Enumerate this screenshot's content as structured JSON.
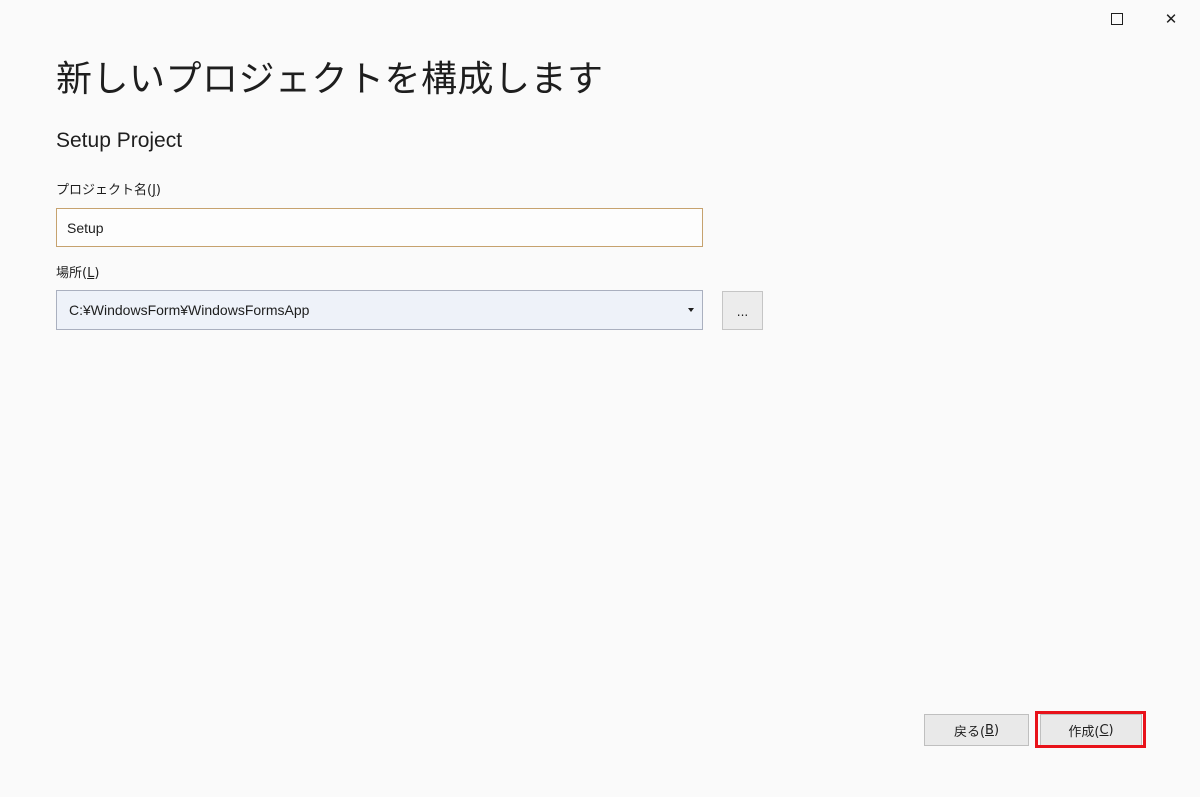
{
  "titlebar": {
    "maximize_icon": "maximize-icon",
    "close_icon": "close-icon",
    "close_glyph": "✕"
  },
  "page": {
    "title": "新しいプロジェクトを構成します",
    "subtitle": "Setup Project"
  },
  "project_name": {
    "label": "プロジェクト名(",
    "mnemonic": "J",
    "label_end": ")",
    "value": "Setup"
  },
  "location": {
    "label": "場所(",
    "mnemonic": "L",
    "label_end": ")",
    "value": "C:¥WindowsForm¥WindowsFormsApp",
    "browse_label": "..."
  },
  "footer": {
    "back": {
      "label": "戻る(",
      "mnemonic": "B",
      "label_end": ")"
    },
    "create": {
      "label": "作成(",
      "mnemonic": "C",
      "label_end": ")"
    }
  },
  "colors": {
    "highlight": "#e8121a",
    "input_border": "#c6a26e"
  }
}
